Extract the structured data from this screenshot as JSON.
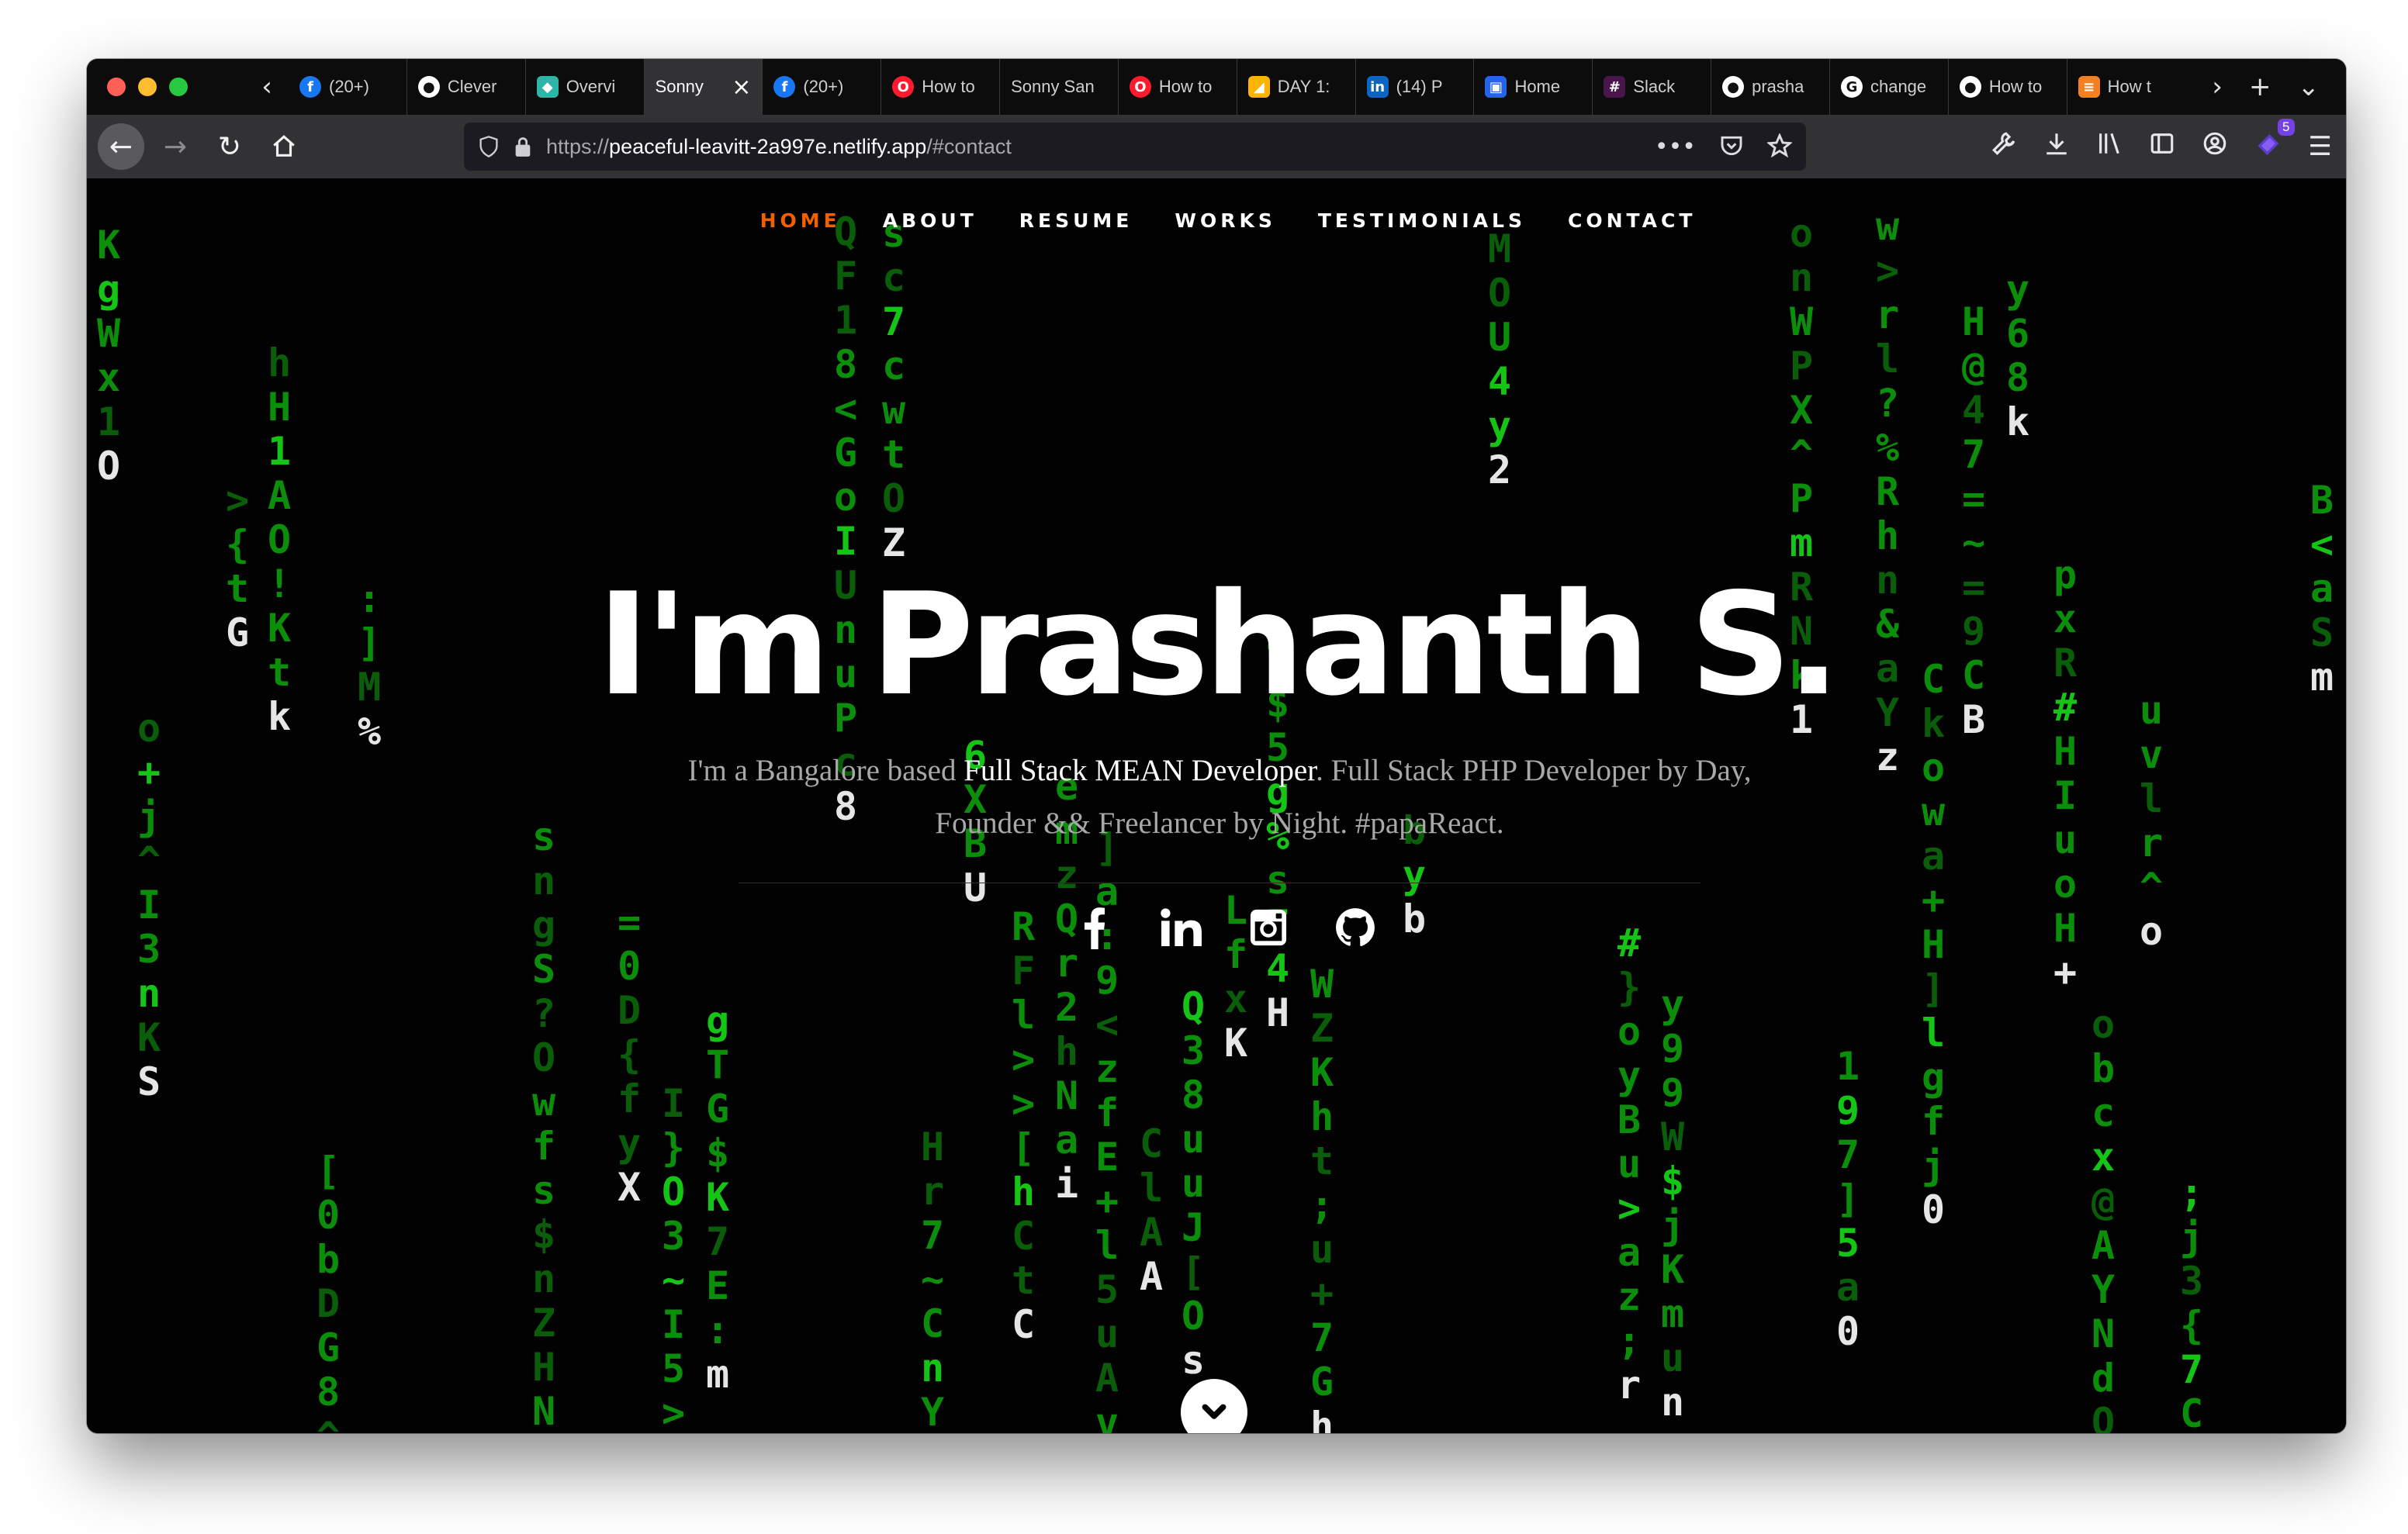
{
  "browser": {
    "tabs": [
      {
        "label": "(20+)",
        "icon": "facebook-icon",
        "color": "#1877f2",
        "glyph": "f"
      },
      {
        "label": "Clever",
        "icon": "github-icon",
        "color": "#ffffff",
        "glyph": "●"
      },
      {
        "label": "Overvi",
        "icon": "netlify-icon",
        "color": "#2db5a8",
        "glyph": "◆"
      },
      {
        "label": "Sonny",
        "icon": "none",
        "color": "",
        "glyph": "",
        "active": true
      },
      {
        "label": "(20+)",
        "icon": "facebook-icon",
        "color": "#1877f2",
        "glyph": "f"
      },
      {
        "label": "How to",
        "icon": "opera-icon",
        "color": "#ff1b2d",
        "glyph": "O"
      },
      {
        "label": "Sonny San",
        "icon": "none",
        "color": "",
        "glyph": ""
      },
      {
        "label": "How to",
        "icon": "opera-icon",
        "color": "#ff1b2d",
        "glyph": "O"
      },
      {
        "label": "DAY 1:",
        "icon": "airtable-icon",
        "color": "#fcb400",
        "glyph": "◢"
      },
      {
        "label": "(14) P",
        "icon": "linkedin-icon",
        "color": "#0a66c2",
        "glyph": "in"
      },
      {
        "label": "Home",
        "icon": "app-icon",
        "color": "#2563eb",
        "glyph": "▣"
      },
      {
        "label": "Slack",
        "icon": "slack-icon",
        "color": "#4a154b",
        "glyph": "#"
      },
      {
        "label": "prasha",
        "icon": "github-icon",
        "color": "#ffffff",
        "glyph": "●"
      },
      {
        "label": "change",
        "icon": "google-icon",
        "color": "#ffffff",
        "glyph": "G"
      },
      {
        "label": "How to",
        "icon": "github-icon",
        "color": "#ffffff",
        "glyph": "●"
      },
      {
        "label": "How t",
        "icon": "stackoverflow-icon",
        "color": "#f48024",
        "glyph": "≡"
      }
    ],
    "url": {
      "scheme": "https://",
      "host": "peaceful-leavitt-2a997e.netlify.app",
      "path": "/#contact"
    },
    "extension_badge": "5"
  },
  "site": {
    "nav": [
      "HOME",
      "ABOUT",
      "RESUME",
      "WORKS",
      "TESTIMONIALS",
      "CONTACT"
    ],
    "title": "I'm Prashanth S.",
    "intro_pre": "I'm a Bangalore based",
    "intro_strong": "Full Stack MEAN Developer",
    "intro_post": ". Full Stack PHP Developer by Day, Founder && Freelancer by Night. #papaReact.",
    "social": [
      "facebook-icon",
      "linkedin-icon",
      "instagram-icon",
      "github-icon"
    ]
  },
  "colors": {
    "matrix_green": "#0b8f0b",
    "nav_active": "#f06000",
    "page_bg": "#020202"
  }
}
